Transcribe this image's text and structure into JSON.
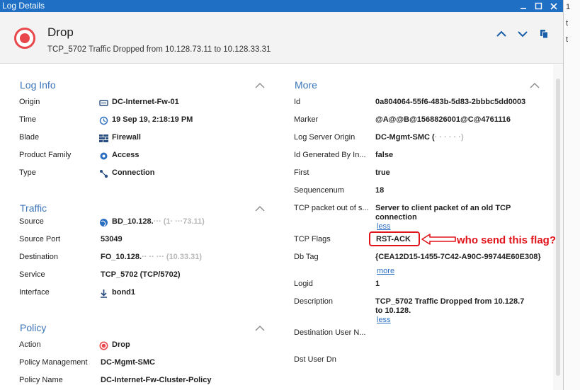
{
  "window": {
    "title": "Log Details"
  },
  "header": {
    "title": "Drop",
    "subtitle": "TCP_5702 Traffic Dropped from 10.128.73.11 to 10.128.33.31"
  },
  "right_strip": {
    "chars": [
      "1",
      "t",
      "t"
    ]
  },
  "log_info": {
    "title": "Log Info",
    "rows": [
      {
        "label": "Origin",
        "value": "DC-Internet-Fw-01",
        "icon": "gateway-icon"
      },
      {
        "label": "Time",
        "value": "19 Sep 19, 2:18:19 PM",
        "icon": "clock-icon"
      },
      {
        "label": "Blade",
        "value": "Firewall",
        "icon": "firewall-icon"
      },
      {
        "label": "Product Family",
        "value": "Access",
        "icon": "access-icon"
      },
      {
        "label": "Type",
        "value": "Connection",
        "icon": "connection-icon"
      }
    ]
  },
  "traffic": {
    "title": "Traffic",
    "rows": [
      {
        "label": "Source",
        "value": "BD_10.128.",
        "value_blurred": "··· (1· ···73.11)",
        "icon": "globe-icon"
      },
      {
        "label": "Source Port",
        "value": "53049"
      },
      {
        "label": "Destination",
        "value": "FO_10.128.",
        "value_blurred": "·· ·· ··· (10.33.31)"
      },
      {
        "label": "Service",
        "value": "TCP_5702 (TCP/5702)"
      },
      {
        "label": "Interface",
        "value": "bond1",
        "icon": "interface-icon"
      }
    ]
  },
  "policy": {
    "title": "Policy",
    "rows": [
      {
        "label": "Action",
        "value": "Drop",
        "icon": "drop-icon"
      },
      {
        "label": "Policy Management",
        "value": "DC-Mgmt-SMC"
      },
      {
        "label": "Policy Name",
        "value": "DC-Internet-Fw-Cluster-Policy"
      }
    ]
  },
  "more": {
    "title": "More",
    "rows": [
      {
        "label": "Id",
        "value": "0a804064-55f6-483b-5d83-2bbbc5dd0003"
      },
      {
        "label": "Marker",
        "value": "@A@@B@1568826001@C@4761116"
      },
      {
        "label": "Log Server Origin",
        "value": "DC-Mgmt-SMC (",
        "value_blurred": "· · ·  · · ·)"
      },
      {
        "label": "Id Generated By In...",
        "value": "false"
      },
      {
        "label": "First",
        "value": "true"
      },
      {
        "label": "Sequencenum",
        "value": "18"
      },
      {
        "label": "TCP packet out of s...",
        "value": "Server to client packet of an old TCP",
        "value2": "connection",
        "link": "less"
      },
      {
        "label": "TCP Flags",
        "value": "RST-ACK"
      },
      {
        "label": "Db Tag",
        "value": "{CEA12D15-1455-7C42-A90C-99744E60E308}",
        "link": "more"
      },
      {
        "label": "Logid",
        "value": "1"
      },
      {
        "label": "Description",
        "value": "TCP_5702 Traffic Dropped from 10.128.7",
        "value2": "to 10.128.",
        "link": "less"
      },
      {
        "label": "Destination User N..."
      },
      {
        "label": "Dst User Dn"
      }
    ]
  },
  "annotation": {
    "text": "who send this flag?"
  },
  "colors": {
    "titlebar": "#1f6fc5",
    "accent": "#3b74b8",
    "drop": "#e8474c",
    "annotation": "#e0141b"
  }
}
